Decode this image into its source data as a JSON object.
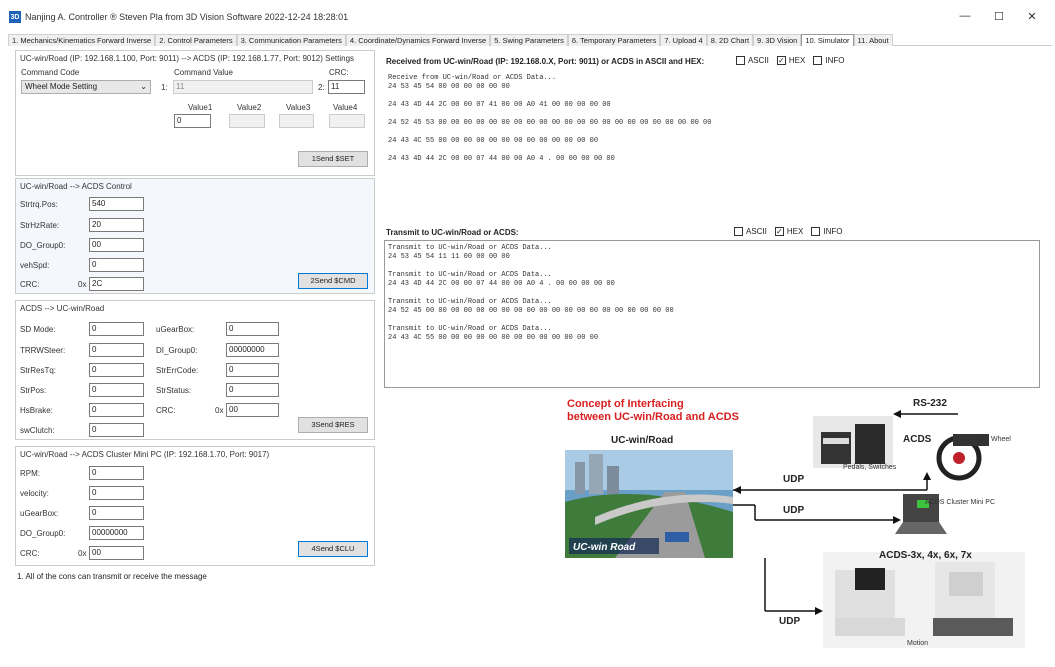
{
  "window": {
    "title": "Nanjing A. Controller ® Steven Pla from 3D Vision Software 2022-12-24 18:28:01",
    "app_icon_text": "3D",
    "minimize": "—",
    "maximize": "☐",
    "close": "✕"
  },
  "tabs": [
    {
      "label": "1. Mechanics/Kinematics Forward Inverse"
    },
    {
      "label": "2. Control Parameters"
    },
    {
      "label": "3. Communication Parameters"
    },
    {
      "label": "4. Coordinate/Dynamics Forward Inverse"
    },
    {
      "label": "5. Swing Parameters"
    },
    {
      "label": "6. Temporary Parameters"
    },
    {
      "label": "7. Upload 4"
    },
    {
      "label": "8. 2D Chart"
    },
    {
      "label": "9. 3D Vision"
    },
    {
      "label": "10. Simulator"
    },
    {
      "label": "11. About"
    }
  ],
  "settings": {
    "title": "UC-win/Road (IP: 192.168.1.100, Port: 9011) --> ACDS (IP: 192.168.1.77, Port: 9012) Settings",
    "command_code_label": "Command Code",
    "command_code_value": "Wheel Mode Setting",
    "command_value_label": "Command Value",
    "crc_label": "CRC:",
    "prefix_one": "1:",
    "prefix_two": "2:",
    "command_value": "11",
    "crc_value": "11",
    "value_labels": [
      "Value1",
      "Value2",
      "Value3",
      "Value4"
    ],
    "value1": "0",
    "send_label": "1Send $SET"
  },
  "control": {
    "title": "UC-win/Road --> ACDS Control",
    "rows": [
      {
        "label": "Strtrq.Pos:",
        "value": "540"
      },
      {
        "label": "StrHzRate:",
        "value": "20"
      },
      {
        "label": "DO_Group0:",
        "value": "00"
      },
      {
        "label": "vehSpd:",
        "value": "0"
      }
    ],
    "crc_label": "CRC:",
    "crc_prefix": "0x",
    "crc_value": "2C",
    "send_label": "2Send $CMD"
  },
  "acds": {
    "title": "ACDS --> UC-win/Road",
    "left_rows": [
      {
        "label": "SD Mode:",
        "value": "0"
      },
      {
        "label": "TRRWSteer:",
        "value": "0"
      },
      {
        "label": "StrResTq:",
        "value": "0"
      },
      {
        "label": "StrPos:",
        "value": "0"
      },
      {
        "label": "HsBrake:",
        "value": "0"
      },
      {
        "label": "swClutch:",
        "value": "0"
      }
    ],
    "right_rows": [
      {
        "label": "uGearBox:",
        "value": "0"
      },
      {
        "label": "DI_Group0:",
        "value": "00000000"
      },
      {
        "label": "StrErrCode:",
        "value": "0"
      },
      {
        "label": "StrStatus:",
        "value": "0"
      },
      {
        "label": "CRC:",
        "prefix": "0x",
        "value": "00"
      }
    ],
    "send_label": "3Send $RES"
  },
  "cluster": {
    "title": "UC-win/Road --> ACDS Cluster Mini PC (IP: 192.168.1.70, Port: 9017)",
    "rows": [
      {
        "label": "RPM:",
        "value": "0"
      },
      {
        "label": "velocity:",
        "value": "0"
      },
      {
        "label": "uGearBox:",
        "value": "0"
      },
      {
        "label": "DO_Group0:",
        "value": "00000000"
      }
    ],
    "crc_label": "CRC:",
    "crc_prefix": "0x",
    "crc_value": "00",
    "send_label": "4Send $CLU"
  },
  "footnote": "1. All of the cons can transmit or receive the message",
  "receive": {
    "header": "Received from UC-win/Road (IP: 192.168.0.X, Port: 9011) or ACDS in ASCII and HEX:",
    "cb_ascii": "ASCII",
    "cb_hex": "HEX",
    "cb_info": "INFO",
    "lines": [
      "Receive from UC-win/Road or ACDS Data...",
      "24 53 45 54 00 00 00 00 00 00",
      "",
      "24 43 4D 44 2C 00 00 07 41 00 00 A0 41 00 00 00 00 00",
      "",
      "24 52 45 53 00 00 00 00 00 00 00 00 00 00 00 00 00 00 00 00 00 00 00 00 00 00",
      "",
      "24 43 4C 55 00 00 00 00 00 00 00 00 00 00 00 00 00",
      "",
      "24 43 4D 44 2C 00 00 07 44 00 00 A0 4 . 00 00 00 00 00"
    ]
  },
  "transmit": {
    "header": "Transmit to UC-win/Road or ACDS:",
    "cb_ascii": "ASCII",
    "cb_hex": "HEX",
    "cb_info": "INFO",
    "lines": [
      "Transmit to UC-win/Road or ACDS Data...",
      "24 53 45 54 11 11 00 00 00 00",
      "",
      "Transmit to UC-win/Road or ACDS Data...",
      "24 43 4D 44 2C 00 00 07 44 00 00 A0 4 . 00 00 00 00 00",
      "",
      "Transmit to UC-win/Road or ACDS Data...",
      "24 52 45 00 00 00 00 00 00 00 00 00 00 00 00 00 00 00 00 00 00 00 00",
      "",
      "Transmit to UC-win/Road or ACDS Data...",
      "24 43 4C 55 00 00 00 00 00 00 00 00 00 00 00 00 00"
    ]
  },
  "diagram": {
    "title_line1": "Concept of Interfacing",
    "title_line2": "between UC-win/Road and ACDS",
    "ucwin_label": "UC-win/Road",
    "logo_text": "UC-win Road",
    "rs232": "RS-232",
    "acds": "ACDS",
    "steering": "Steering Wheel",
    "pedals": "Pedals, Switches",
    "udp1": "UDP",
    "udp2": "UDP",
    "udp3": "UDP",
    "cluster_pc": "ACDS Cluster Mini PC",
    "acds_models": "ACDS-3x, 4x, 6x, 7x",
    "motion": "Motion"
  }
}
